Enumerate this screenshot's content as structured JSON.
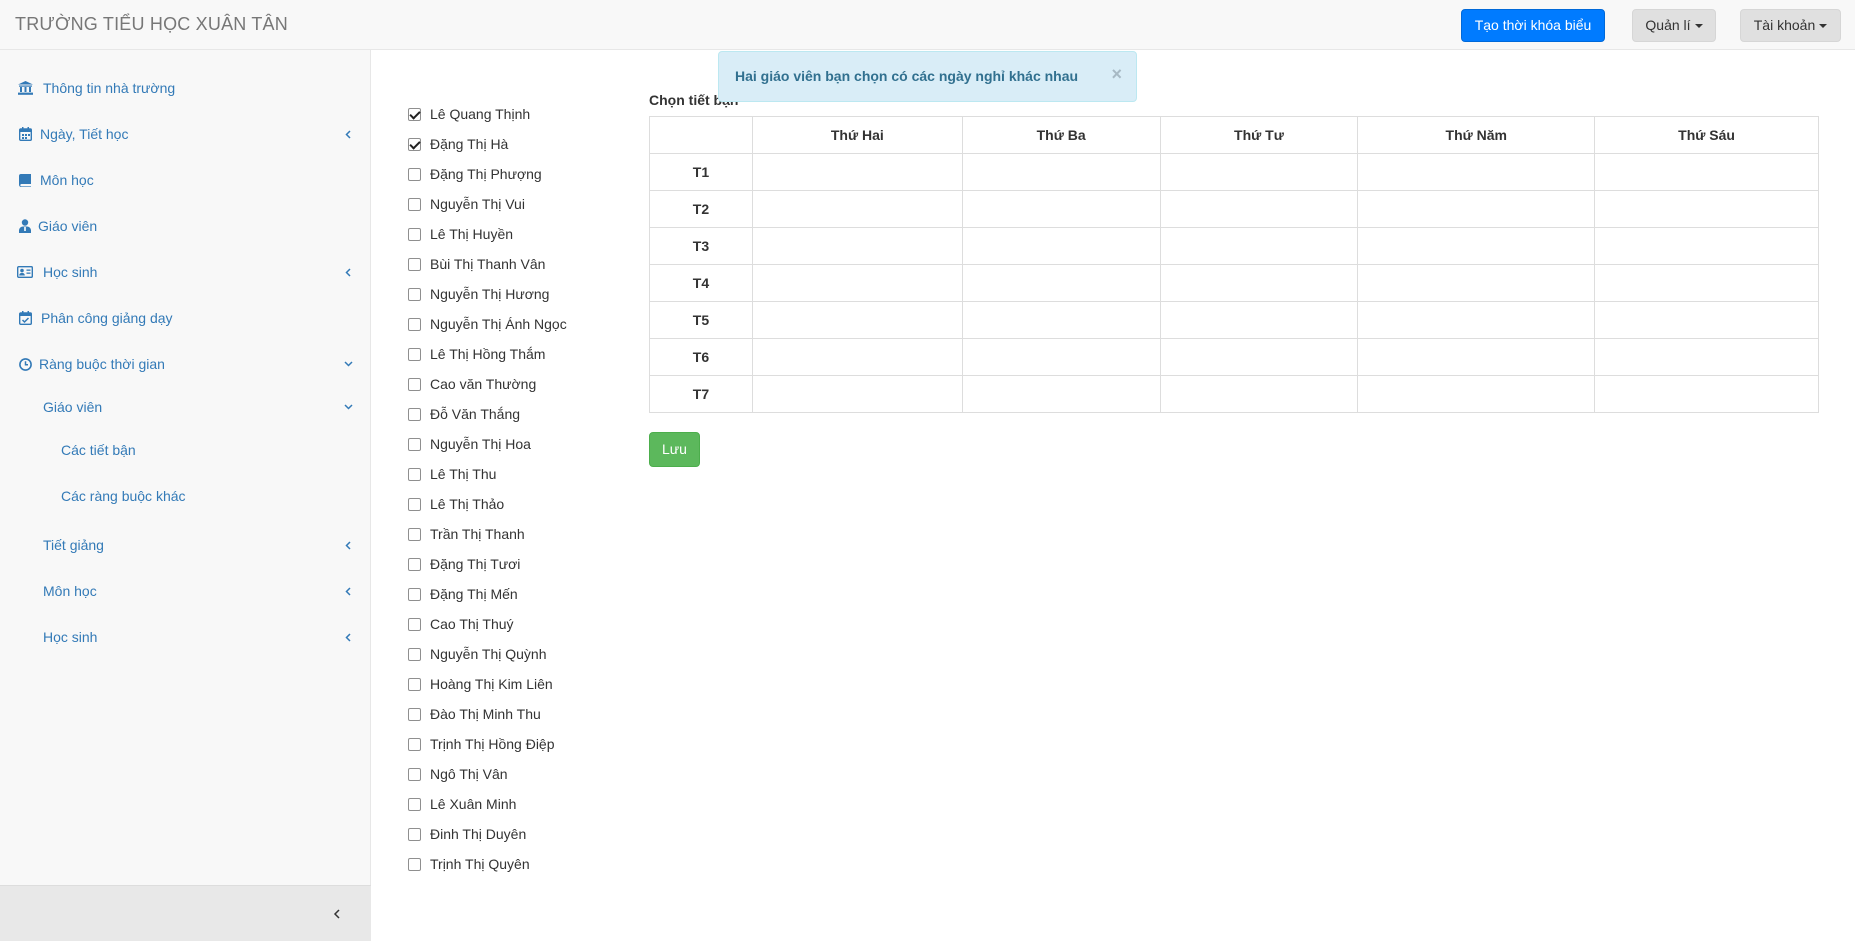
{
  "navbar": {
    "brand": "TRƯỜNG TIỂU HỌC XUÂN TÂN",
    "create_timetable": "Tạo thời khóa biểu",
    "manage": "Quản lí",
    "account": "Tài khoản"
  },
  "sidebar": {
    "items": [
      {
        "label": "Thông tin nhà trường",
        "icon": "bank-icon"
      },
      {
        "label": "Ngày, Tiết học",
        "icon": "calendar-icon"
      },
      {
        "label": "Môn học",
        "icon": "book-icon"
      },
      {
        "label": "Giáo viên",
        "icon": "teacher-icon"
      },
      {
        "label": "Học sinh",
        "icon": "id-card-icon"
      },
      {
        "label": "Phân công giảng dạy",
        "icon": "calendar-check-icon"
      },
      {
        "label": "Ràng buộc thời gian",
        "icon": "clock-icon"
      },
      {
        "label": "Giáo viên"
      },
      {
        "label": "Các tiết bận"
      },
      {
        "label": "Các ràng buộc khác"
      },
      {
        "label": "Tiết giảng"
      },
      {
        "label": "Môn học"
      },
      {
        "label": "Học sinh"
      }
    ]
  },
  "alert": {
    "message": "Hai giáo viên bạn chọn có các ngày nghỉ khác nhau",
    "close": "×"
  },
  "teachers": [
    {
      "name": "Lê Quang Thịnh",
      "checked": true
    },
    {
      "name": "Đặng Thị Hà",
      "checked": true
    },
    {
      "name": "Đặng Thị Phượng",
      "checked": false
    },
    {
      "name": "Nguyễn Thị Vui",
      "checked": false
    },
    {
      "name": "Lê Thị Huyền",
      "checked": false
    },
    {
      "name": "Bùi Thị Thanh Vân",
      "checked": false
    },
    {
      "name": "Nguyễn Thị Hương",
      "checked": false
    },
    {
      "name": "Nguyễn Thị Ánh Ngọc",
      "checked": false
    },
    {
      "name": "Lê Thị Hồng Thắm",
      "checked": false
    },
    {
      "name": "Cao văn Thường",
      "checked": false
    },
    {
      "name": "Đỗ Văn Thắng",
      "checked": false
    },
    {
      "name": "Nguyễn Thị Hoa",
      "checked": false
    },
    {
      "name": "Lê Thị Thu",
      "checked": false
    },
    {
      "name": "Lê Thị Thảo",
      "checked": false
    },
    {
      "name": "Trần Thị Thanh",
      "checked": false
    },
    {
      "name": "Đặng Thị Tươi",
      "checked": false
    },
    {
      "name": "Đặng Thị Mến",
      "checked": false
    },
    {
      "name": "Cao Thị Thuý",
      "checked": false
    },
    {
      "name": "Nguyễn Thị Quỳnh",
      "checked": false
    },
    {
      "name": "Hoàng Thị Kim Liên",
      "checked": false
    },
    {
      "name": "Đào Thị Minh Thu",
      "checked": false
    },
    {
      "name": "Trịnh Thị Hồng Điệp",
      "checked": false
    },
    {
      "name": "Ngô Thị Vân",
      "checked": false
    },
    {
      "name": "Lê Xuân Minh",
      "checked": false
    },
    {
      "name": "Đinh Thị Duyên",
      "checked": false
    },
    {
      "name": "Trịnh Thị Quyên",
      "checked": false
    }
  ],
  "schedule": {
    "title": "Chọn tiết bận",
    "days": [
      "Thứ Hai",
      "Thứ Ba",
      "Thứ Tư",
      "Thứ Năm",
      "Thứ Sáu"
    ],
    "periods": [
      "T1",
      "T2",
      "T3",
      "T4",
      "T5",
      "T6",
      "T7"
    ],
    "save_label": "Lưu"
  },
  "colors": {
    "primary": "#007bff",
    "link": "#337ab7",
    "success": "#5cb85c",
    "info_bg": "#d9edf7",
    "info_text": "#31708f"
  }
}
